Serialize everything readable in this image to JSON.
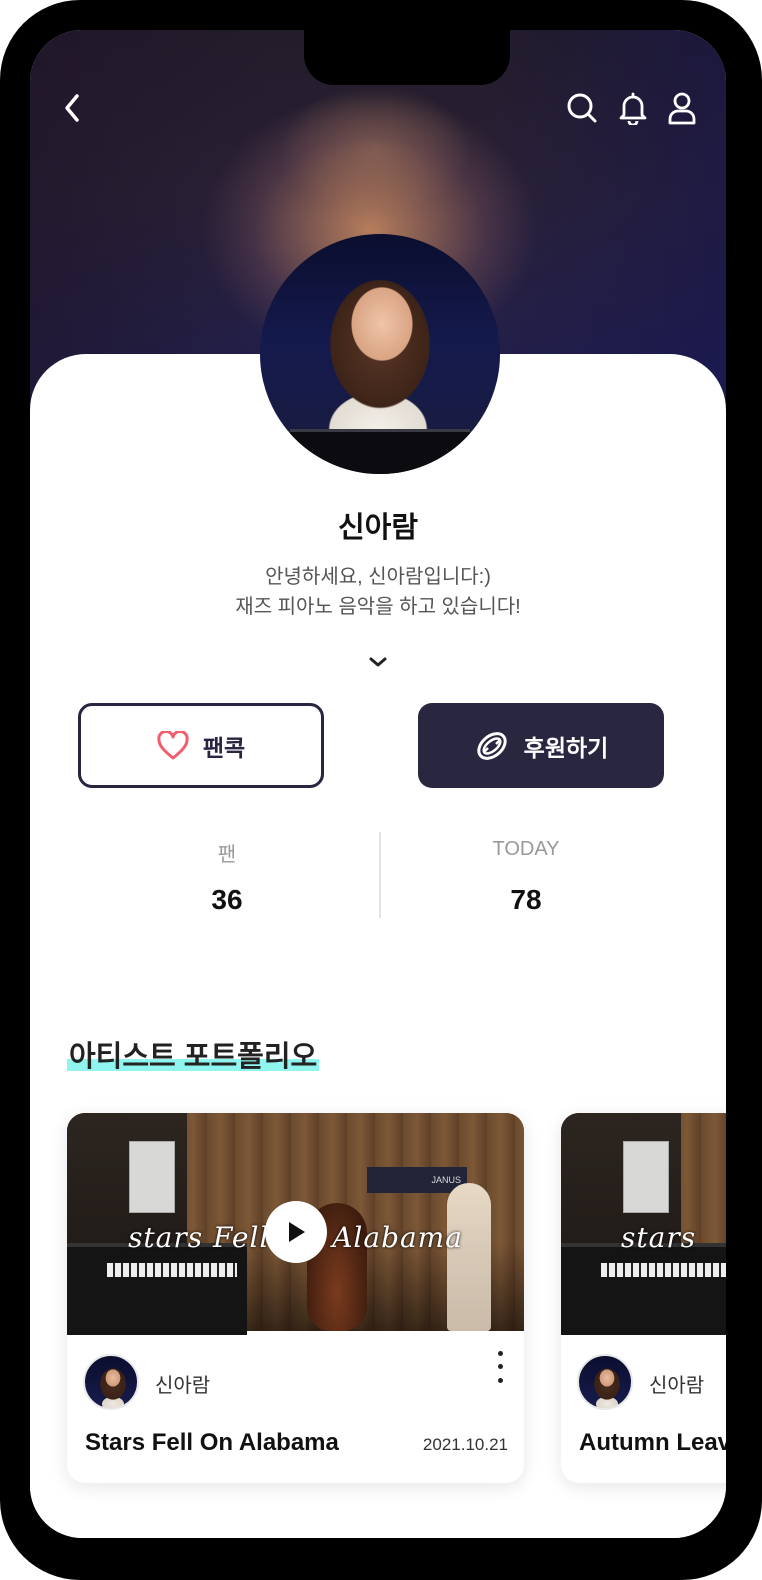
{
  "header": {
    "back_icon": "chevron-left-icon",
    "search_icon": "search-icon",
    "bell_icon": "bell-icon",
    "user_icon": "user-icon"
  },
  "profile": {
    "name": "신아람",
    "bio_line1": "안녕하세요, 신아람입니다:)",
    "bio_line2": "재즈 피아노 음악을 하고 있습니다!",
    "expand_icon": "chevron-down-icon"
  },
  "actions": {
    "fan_label": "팬콕",
    "support_label": "후원하기",
    "heart_color": "#f25c6c",
    "primary_color": "#29263f"
  },
  "stats": {
    "fans_label": "팬",
    "fans_value": "36",
    "today_label": "TODAY",
    "today_value": "78"
  },
  "portfolio": {
    "title": "아티스트 포트폴리오",
    "highlight_color": "#8ff5ee",
    "cards": [
      {
        "overlay_text": "stars Fell On Alabama",
        "author": "신아람",
        "title": "Stars Fell On Alabama",
        "date": "2021.10.21",
        "sign_text": "JANUS"
      },
      {
        "overlay_text": "stars",
        "author": "신아람",
        "title": "Autumn Leaves",
        "date": ""
      }
    ]
  }
}
